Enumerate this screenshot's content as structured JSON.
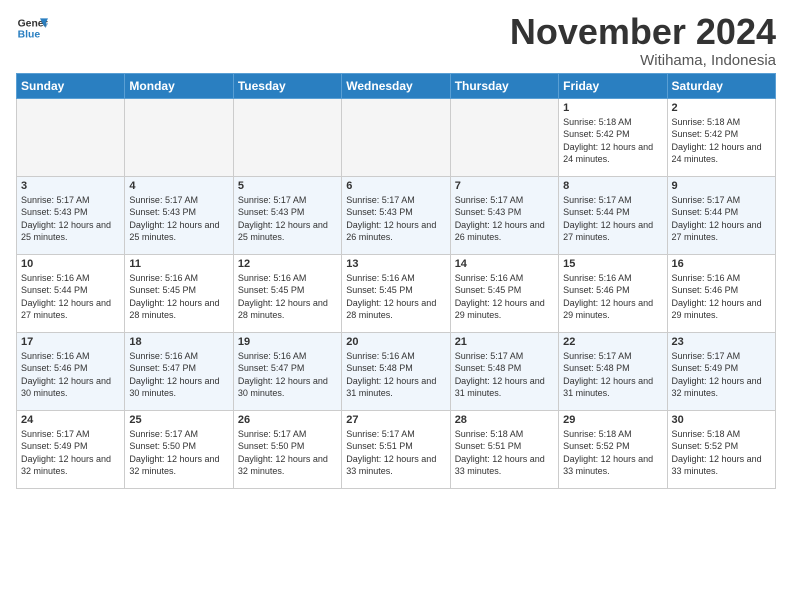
{
  "logo": {
    "line1": "General",
    "line2": "Blue"
  },
  "title": "November 2024",
  "location": "Witihama, Indonesia",
  "weekdays": [
    "Sunday",
    "Monday",
    "Tuesday",
    "Wednesday",
    "Thursday",
    "Friday",
    "Saturday"
  ],
  "weeks": [
    [
      {
        "day": "",
        "empty": true
      },
      {
        "day": "",
        "empty": true
      },
      {
        "day": "",
        "empty": true
      },
      {
        "day": "",
        "empty": true
      },
      {
        "day": "",
        "empty": true
      },
      {
        "day": "1",
        "rise": "5:18 AM",
        "set": "5:42 PM",
        "daylight": "12 hours and 24 minutes."
      },
      {
        "day": "2",
        "rise": "5:18 AM",
        "set": "5:42 PM",
        "daylight": "12 hours and 24 minutes."
      }
    ],
    [
      {
        "day": "3",
        "rise": "5:17 AM",
        "set": "5:43 PM",
        "daylight": "12 hours and 25 minutes."
      },
      {
        "day": "4",
        "rise": "5:17 AM",
        "set": "5:43 PM",
        "daylight": "12 hours and 25 minutes."
      },
      {
        "day": "5",
        "rise": "5:17 AM",
        "set": "5:43 PM",
        "daylight": "12 hours and 25 minutes."
      },
      {
        "day": "6",
        "rise": "5:17 AM",
        "set": "5:43 PM",
        "daylight": "12 hours and 26 minutes."
      },
      {
        "day": "7",
        "rise": "5:17 AM",
        "set": "5:43 PM",
        "daylight": "12 hours and 26 minutes."
      },
      {
        "day": "8",
        "rise": "5:17 AM",
        "set": "5:44 PM",
        "daylight": "12 hours and 27 minutes."
      },
      {
        "day": "9",
        "rise": "5:17 AM",
        "set": "5:44 PM",
        "daylight": "12 hours and 27 minutes."
      }
    ],
    [
      {
        "day": "10",
        "rise": "5:16 AM",
        "set": "5:44 PM",
        "daylight": "12 hours and 27 minutes."
      },
      {
        "day": "11",
        "rise": "5:16 AM",
        "set": "5:45 PM",
        "daylight": "12 hours and 28 minutes."
      },
      {
        "day": "12",
        "rise": "5:16 AM",
        "set": "5:45 PM",
        "daylight": "12 hours and 28 minutes."
      },
      {
        "day": "13",
        "rise": "5:16 AM",
        "set": "5:45 PM",
        "daylight": "12 hours and 28 minutes."
      },
      {
        "day": "14",
        "rise": "5:16 AM",
        "set": "5:45 PM",
        "daylight": "12 hours and 29 minutes."
      },
      {
        "day": "15",
        "rise": "5:16 AM",
        "set": "5:46 PM",
        "daylight": "12 hours and 29 minutes."
      },
      {
        "day": "16",
        "rise": "5:16 AM",
        "set": "5:46 PM",
        "daylight": "12 hours and 29 minutes."
      }
    ],
    [
      {
        "day": "17",
        "rise": "5:16 AM",
        "set": "5:46 PM",
        "daylight": "12 hours and 30 minutes."
      },
      {
        "day": "18",
        "rise": "5:16 AM",
        "set": "5:47 PM",
        "daylight": "12 hours and 30 minutes."
      },
      {
        "day": "19",
        "rise": "5:16 AM",
        "set": "5:47 PM",
        "daylight": "12 hours and 30 minutes."
      },
      {
        "day": "20",
        "rise": "5:16 AM",
        "set": "5:48 PM",
        "daylight": "12 hours and 31 minutes."
      },
      {
        "day": "21",
        "rise": "5:17 AM",
        "set": "5:48 PM",
        "daylight": "12 hours and 31 minutes."
      },
      {
        "day": "22",
        "rise": "5:17 AM",
        "set": "5:48 PM",
        "daylight": "12 hours and 31 minutes."
      },
      {
        "day": "23",
        "rise": "5:17 AM",
        "set": "5:49 PM",
        "daylight": "12 hours and 32 minutes."
      }
    ],
    [
      {
        "day": "24",
        "rise": "5:17 AM",
        "set": "5:49 PM",
        "daylight": "12 hours and 32 minutes."
      },
      {
        "day": "25",
        "rise": "5:17 AM",
        "set": "5:50 PM",
        "daylight": "12 hours and 32 minutes."
      },
      {
        "day": "26",
        "rise": "5:17 AM",
        "set": "5:50 PM",
        "daylight": "12 hours and 32 minutes."
      },
      {
        "day": "27",
        "rise": "5:17 AM",
        "set": "5:51 PM",
        "daylight": "12 hours and 33 minutes."
      },
      {
        "day": "28",
        "rise": "5:18 AM",
        "set": "5:51 PM",
        "daylight": "12 hours and 33 minutes."
      },
      {
        "day": "29",
        "rise": "5:18 AM",
        "set": "5:52 PM",
        "daylight": "12 hours and 33 minutes."
      },
      {
        "day": "30",
        "rise": "5:18 AM",
        "set": "5:52 PM",
        "daylight": "12 hours and 33 minutes."
      }
    ]
  ]
}
